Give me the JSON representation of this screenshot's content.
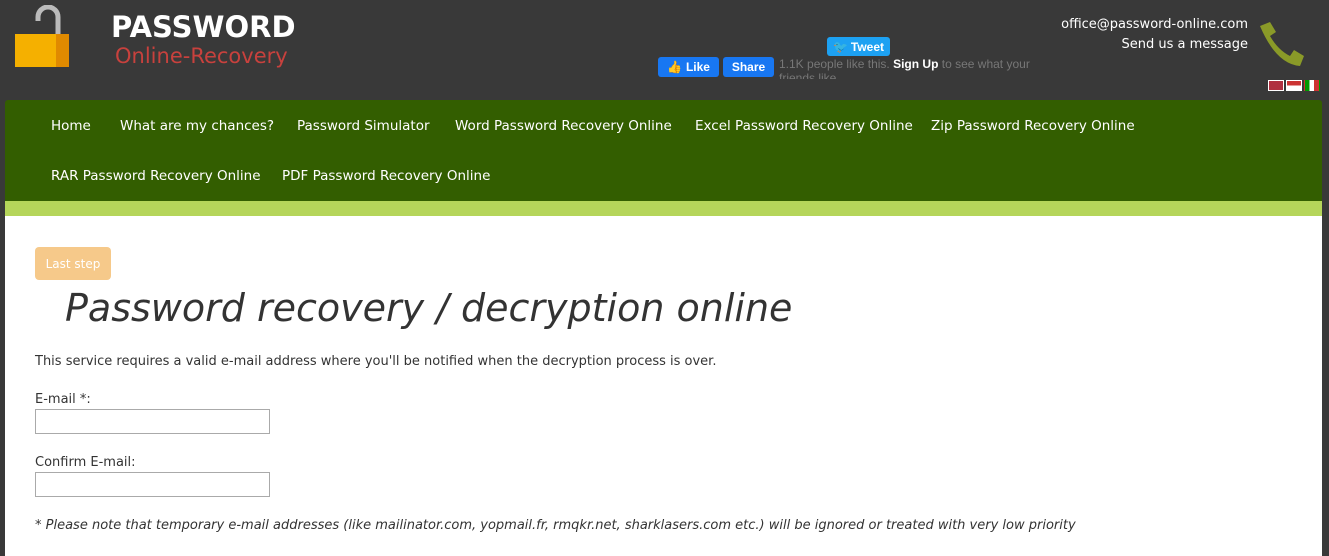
{
  "header": {
    "brand_title": "PASSWORD",
    "brand_subtitle": "Online-Recovery",
    "tweet_label": "Tweet",
    "like_label": "Like",
    "share_label": "Share",
    "fb_count": "1.1K people like this.",
    "fb_signup": "Sign Up",
    "fb_rest": "to see what your friends like.",
    "email": "office@password-online.com",
    "message_link": "Send us a message",
    "flags": [
      "uk-flag",
      "us-flag",
      "italy-flag"
    ]
  },
  "nav": {
    "items": [
      "Home",
      "What are my chances?",
      "Password Simulator",
      "Word Password Recovery Online",
      "Excel Password Recovery Online",
      "Zip Password Recovery Online",
      "RAR Password Recovery Online",
      "PDF Password Recovery Online"
    ]
  },
  "main": {
    "step_badge": "Last step",
    "title": "Password recovery / decryption online",
    "intro": "This service requires a valid e-mail address where you'll be notified when the decryption process is over.",
    "email_label": "E-mail *:",
    "email_value": "",
    "confirm_label": "Confirm E-mail:",
    "confirm_value": "",
    "note": "* Please note that temporary e-mail addresses (like mailinator.com, yopmail.fr, rmqkr.net, sharklasers.com etc.) will be ignored or treated with very low priority"
  },
  "colors": {
    "nav": "#335e00",
    "strip": "#b5d55a",
    "badge": "#f6c98a",
    "brand_red": "#c8413d"
  }
}
